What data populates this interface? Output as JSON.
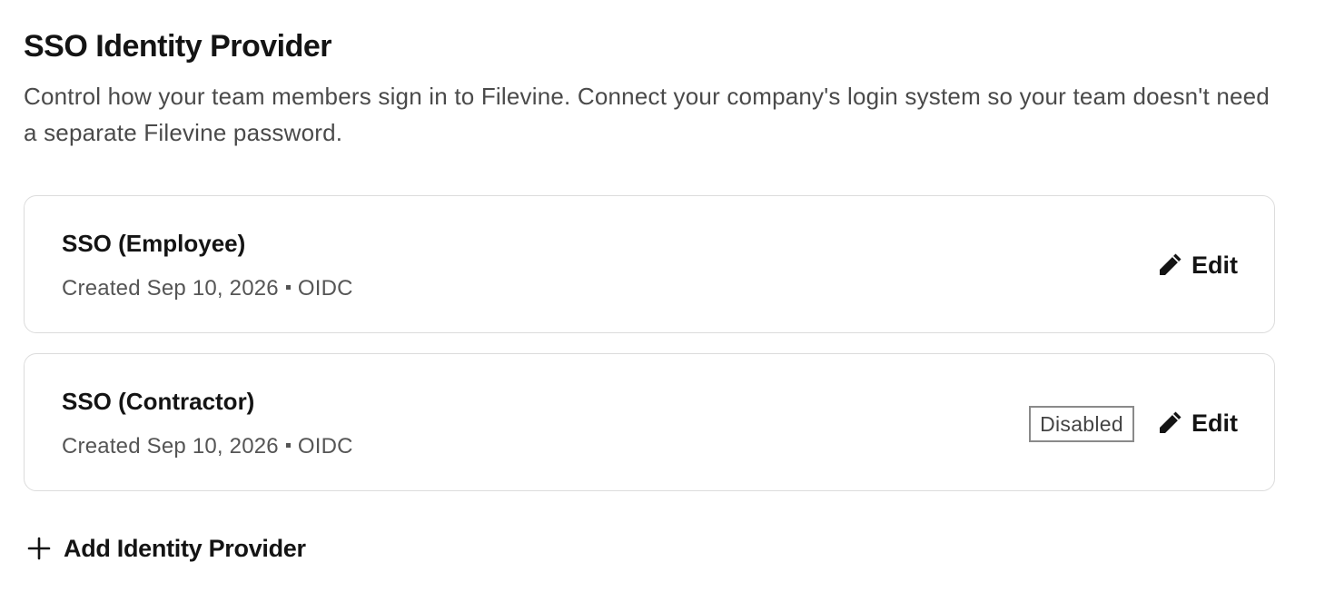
{
  "section": {
    "title": "SSO Identity Provider",
    "description": "Control how your team members sign in to Filevine. Connect your company's login system so your team doesn't need a separate Filevine password."
  },
  "providers": [
    {
      "name": "SSO (Employee)",
      "created": "Created Sep 10, 2026",
      "protocol": "OIDC",
      "status": null,
      "edit_label": "Edit"
    },
    {
      "name": "SSO (Contractor)",
      "created": "Created Sep 10, 2026",
      "protocol": "OIDC",
      "status": "Disabled",
      "edit_label": "Edit"
    }
  ],
  "actions": {
    "add_label": "Add Identity Provider"
  },
  "icons": {
    "edit": "pencil-icon",
    "add": "plus-icon"
  }
}
